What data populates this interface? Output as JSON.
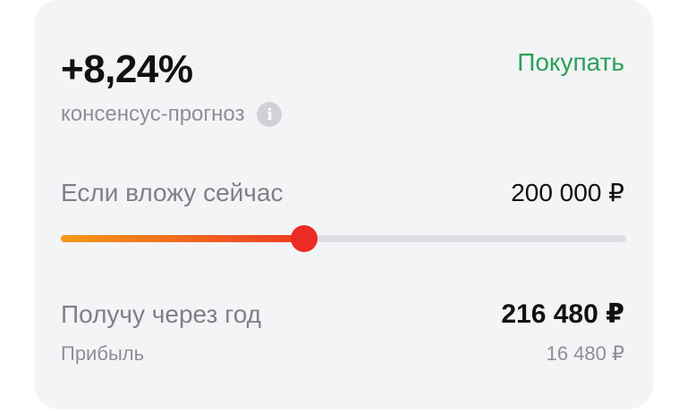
{
  "forecast": {
    "value": "+8,24%",
    "label": "консенсус-прогноз",
    "recommendation": "Покупать",
    "info_icon": "info-icon"
  },
  "investment": {
    "label": "Если вложу сейчас",
    "amount": "200 000 ₽",
    "slider_fraction": 0.43
  },
  "result": {
    "label": "Получу через год",
    "amount": "216 480 ₽",
    "profit_label": "Прибыль",
    "profit_amount": "16 480 ₽"
  },
  "colors": {
    "accent_green": "#2aa05a",
    "slider_start": "#f39a1a",
    "slider_end": "#ee3a24",
    "card_background": "#f3f4f6"
  }
}
